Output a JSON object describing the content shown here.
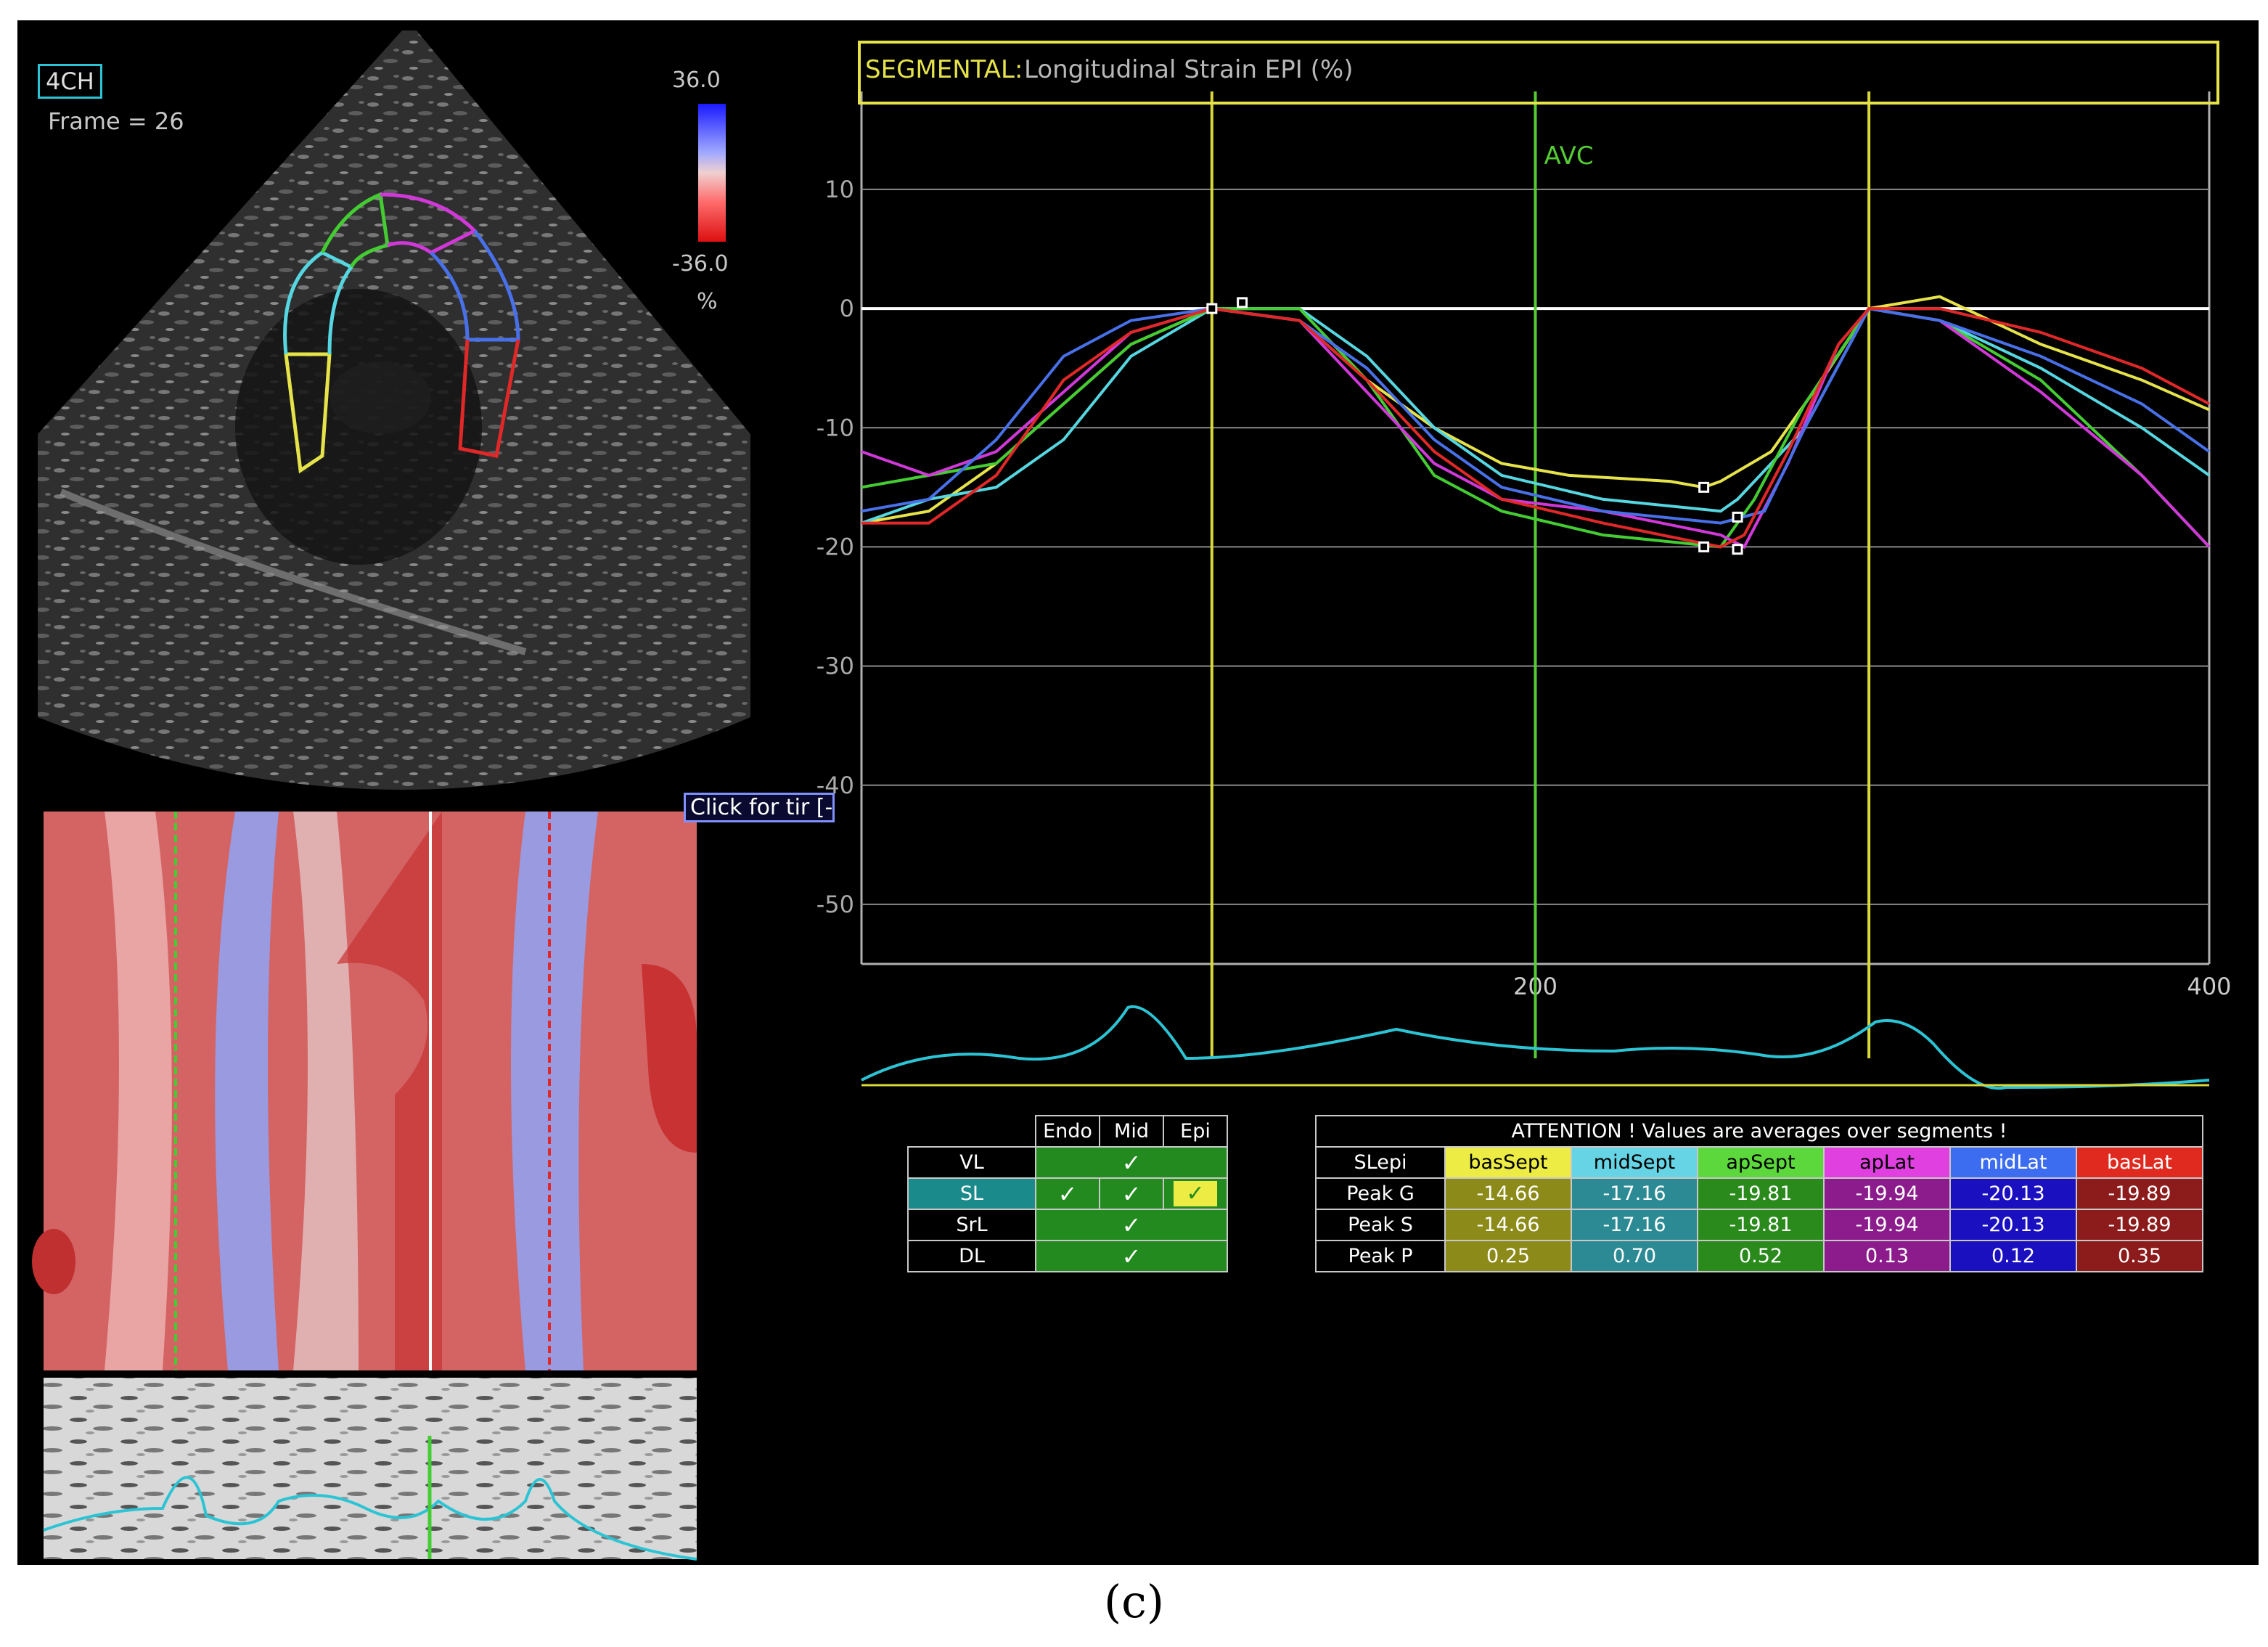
{
  "view": {
    "label": "4CH",
    "frame": "Frame = 26"
  },
  "colorbar": {
    "max": "36.0",
    "min": "-36.0",
    "unit": "%"
  },
  "tooltip": "Click for tir [-",
  "chart_data": {
    "type": "line",
    "title_prefix": "SEGMENTAL:",
    "title": "Longitudinal Strain EPI (%)",
    "ylim": [
      -55,
      17
    ],
    "yticks": [
      "10",
      "0",
      "-10",
      "-20",
      "-30",
      "-40",
      "-50"
    ],
    "ytick_values": [
      10,
      0,
      -10,
      -20,
      -30,
      -40,
      -50
    ],
    "xlim": [
      0,
      400
    ],
    "xtick_labels": [
      "200",
      "400"
    ],
    "xtick_values": [
      200,
      400
    ],
    "markers": [
      {
        "label": "",
        "x": 104,
        "color": "#d8d83a"
      },
      {
        "label": "AVC",
        "x": 200,
        "color": "#55cc33"
      },
      {
        "label": "",
        "x": 299,
        "color": "#d8d83a"
      }
    ],
    "series": [
      {
        "color": "#e6e34a",
        "points": [
          [
            0,
            -18
          ],
          [
            20,
            -17
          ],
          [
            40,
            -13
          ],
          [
            60,
            -8
          ],
          [
            80,
            -3
          ],
          [
            104,
            0
          ],
          [
            130,
            -1
          ],
          [
            150,
            -6
          ],
          [
            170,
            -10
          ],
          [
            190,
            -13
          ],
          [
            210,
            -14
          ],
          [
            240,
            -14.5
          ],
          [
            250,
            -15
          ],
          [
            255,
            -14.5
          ],
          [
            270,
            -12
          ],
          [
            285,
            -6
          ],
          [
            299,
            0
          ],
          [
            320,
            1
          ],
          [
            350,
            -3
          ],
          [
            380,
            -6
          ],
          [
            400,
            -8.5
          ]
        ]
      },
      {
        "color": "#55d6e0",
        "points": [
          [
            0,
            -18
          ],
          [
            20,
            -16
          ],
          [
            40,
            -15
          ],
          [
            60,
            -11
          ],
          [
            80,
            -4
          ],
          [
            104,
            0
          ],
          [
            130,
            0
          ],
          [
            150,
            -4
          ],
          [
            170,
            -10
          ],
          [
            190,
            -14
          ],
          [
            220,
            -16
          ],
          [
            255,
            -17
          ],
          [
            260,
            -16
          ],
          [
            280,
            -10
          ],
          [
            299,
            0
          ],
          [
            320,
            -1
          ],
          [
            350,
            -5
          ],
          [
            380,
            -10
          ],
          [
            400,
            -14
          ]
        ]
      },
      {
        "color": "#44cc33",
        "points": [
          [
            0,
            -15
          ],
          [
            20,
            -14
          ],
          [
            40,
            -13
          ],
          [
            60,
            -8
          ],
          [
            80,
            -3
          ],
          [
            104,
            0
          ],
          [
            130,
            0
          ],
          [
            150,
            -6
          ],
          [
            170,
            -14
          ],
          [
            190,
            -17
          ],
          [
            220,
            -19
          ],
          [
            255,
            -20
          ],
          [
            265,
            -16
          ],
          [
            280,
            -8
          ],
          [
            299,
            0
          ],
          [
            320,
            -1
          ],
          [
            350,
            -6
          ],
          [
            380,
            -14
          ],
          [
            400,
            -20
          ]
        ]
      },
      {
        "color": "#d038d8",
        "points": [
          [
            0,
            -12
          ],
          [
            20,
            -14
          ],
          [
            40,
            -12
          ],
          [
            60,
            -7
          ],
          [
            80,
            -2
          ],
          [
            104,
            0
          ],
          [
            130,
            -1
          ],
          [
            150,
            -7
          ],
          [
            170,
            -13
          ],
          [
            190,
            -16
          ],
          [
            220,
            -17
          ],
          [
            255,
            -19
          ],
          [
            262,
            -20
          ],
          [
            275,
            -13
          ],
          [
            290,
            -3
          ],
          [
            299,
            0
          ],
          [
            320,
            -1
          ],
          [
            350,
            -7
          ],
          [
            380,
            -14
          ],
          [
            400,
            -20
          ]
        ]
      },
      {
        "color": "#4870e8",
        "points": [
          [
            0,
            -17
          ],
          [
            20,
            -16
          ],
          [
            40,
            -11
          ],
          [
            60,
            -4
          ],
          [
            80,
            -1
          ],
          [
            104,
            0
          ],
          [
            130,
            -1
          ],
          [
            150,
            -5
          ],
          [
            170,
            -11
          ],
          [
            190,
            -15
          ],
          [
            220,
            -17
          ],
          [
            255,
            -18
          ],
          [
            268,
            -17
          ],
          [
            280,
            -10
          ],
          [
            299,
            0
          ],
          [
            320,
            -1
          ],
          [
            350,
            -4
          ],
          [
            380,
            -8
          ],
          [
            400,
            -12
          ]
        ]
      },
      {
        "color": "#e02828",
        "points": [
          [
            0,
            -18
          ],
          [
            20,
            -18
          ],
          [
            40,
            -14
          ],
          [
            60,
            -6
          ],
          [
            80,
            -2
          ],
          [
            104,
            0
          ],
          [
            130,
            -1
          ],
          [
            150,
            -6
          ],
          [
            170,
            -12
          ],
          [
            190,
            -16
          ],
          [
            220,
            -18
          ],
          [
            255,
            -20
          ],
          [
            262,
            -19
          ],
          [
            275,
            -12
          ],
          [
            290,
            -3
          ],
          [
            299,
            0
          ],
          [
            320,
            0
          ],
          [
            350,
            -2
          ],
          [
            380,
            -5
          ],
          [
            400,
            -8
          ]
        ]
      }
    ]
  },
  "vtable": {
    "headers": [
      "Endo",
      "Mid",
      "Epi"
    ],
    "rows": [
      {
        "label": "VL",
        "checks": "merged"
      },
      {
        "label": "SL",
        "checks": "separate"
      },
      {
        "label": "SrL",
        "checks": "merged"
      },
      {
        "label": "DL",
        "checks": "merged"
      }
    ],
    "check": "✓"
  },
  "stable": {
    "attention": "ATTENTION !  Values are averages over segments !",
    "corner": "SLepi",
    "segments": [
      "basSept",
      "midSept",
      "apSept",
      "apLat",
      "midLat",
      "basLat"
    ],
    "header_colors": [
      "#ecec44",
      "#66d4e4",
      "#5cd83c",
      "#e040e0",
      "#3c6cf0",
      "#e02a20"
    ],
    "header_text_colors": [
      "#000000",
      "#000000",
      "#000000",
      "#000000",
      "#ffffff",
      "#ffffff"
    ],
    "row_colors": [
      "#8c8a18",
      "#2c8a94",
      "#2a8a1c",
      "#8c1c8c",
      "#1a10c0",
      "#8c1c1c"
    ],
    "rows": [
      {
        "label": "Peak G",
        "values": [
          "-14.66",
          "-17.16",
          "-19.81",
          "-19.94",
          "-20.13",
          "-19.89"
        ]
      },
      {
        "label": "Peak S",
        "values": [
          "-14.66",
          "-17.16",
          "-19.81",
          "-19.94",
          "-20.13",
          "-19.89"
        ]
      },
      {
        "label": "Peak P",
        "values": [
          "0.25",
          "0.70",
          "0.52",
          "0.13",
          "0.12",
          "0.35"
        ]
      }
    ]
  },
  "caption": "(c)"
}
